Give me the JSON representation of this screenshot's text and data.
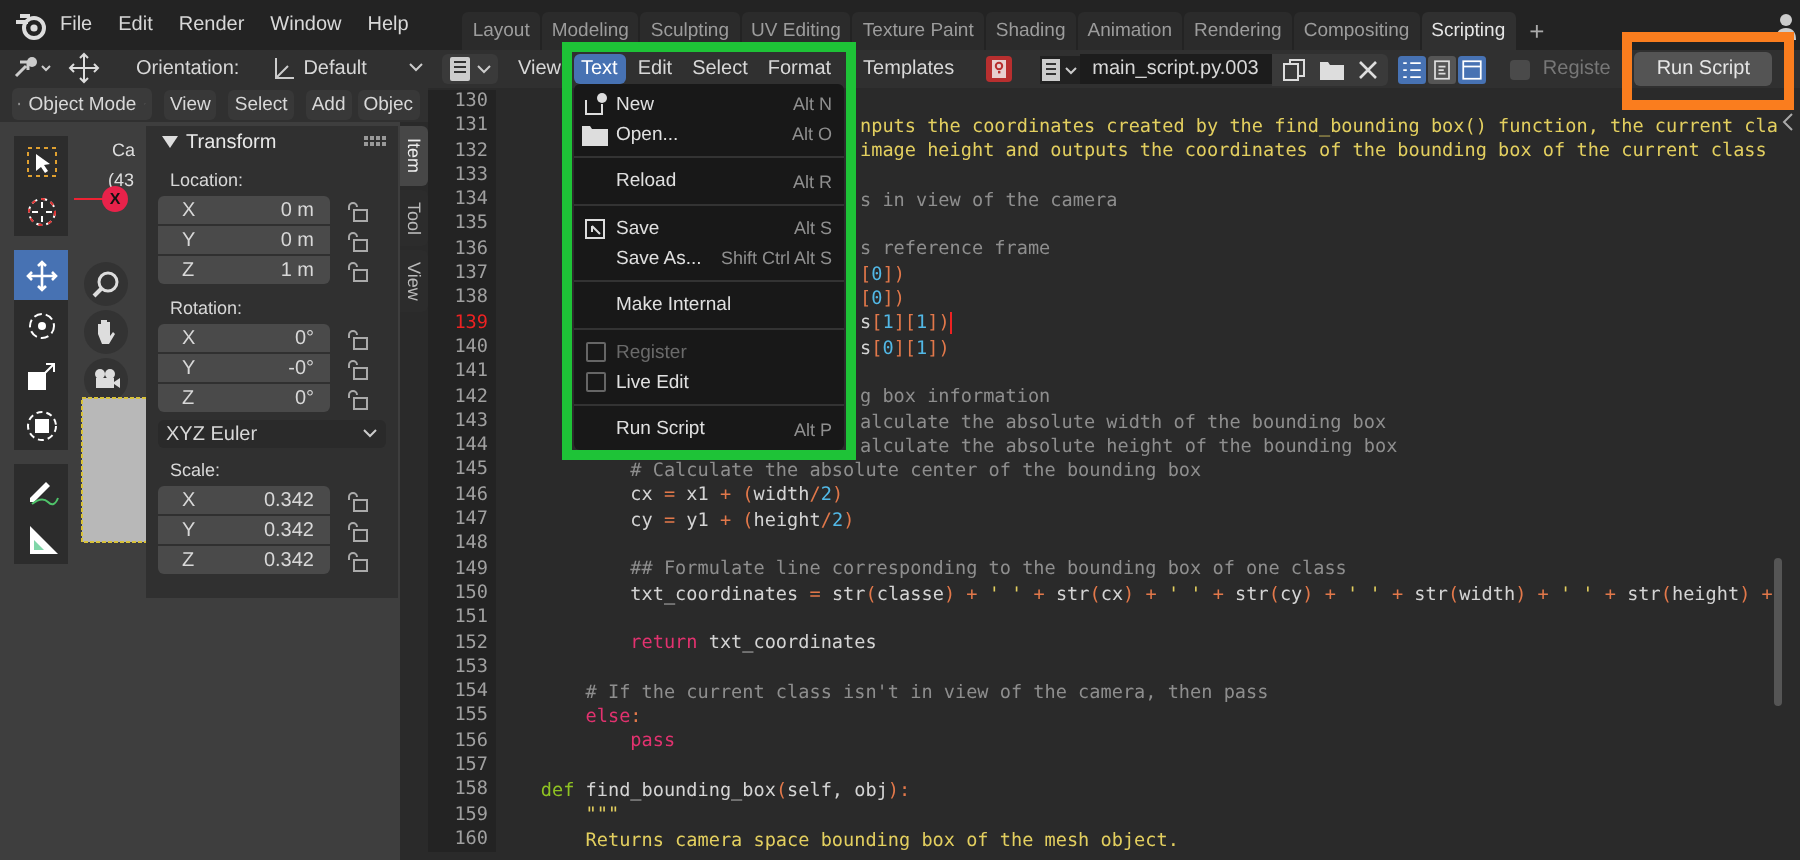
{
  "topbar": {
    "menus": [
      "File",
      "Edit",
      "Render",
      "Window",
      "Help"
    ],
    "workspaces": [
      {
        "label": "Layout",
        "selected": false
      },
      {
        "label": "Modeling",
        "selected": false
      },
      {
        "label": "Sculpting",
        "selected": false
      },
      {
        "label": "UV Editing",
        "selected": false
      },
      {
        "label": "Texture Paint",
        "selected": false
      },
      {
        "label": "Shading",
        "selected": false
      },
      {
        "label": "Animation",
        "selected": false
      },
      {
        "label": "Rendering",
        "selected": false
      },
      {
        "label": "Compositing",
        "selected": false
      },
      {
        "label": "Scripting",
        "selected": true
      }
    ],
    "add_tab": "+"
  },
  "viewport": {
    "orientation_label": "Orientation:",
    "orientation": "Default",
    "mode": "Object Mode",
    "menus": [
      "View",
      "Select",
      "Add",
      "Objec"
    ],
    "overlay_text": [
      "Ca",
      "(43"
    ],
    "axis_handle": "X",
    "tools": [
      {
        "kind": "select-box",
        "selected": false
      },
      {
        "kind": "cursor",
        "selected": false
      },
      {
        "kind": "move",
        "selected": true
      },
      {
        "kind": "rotate",
        "selected": false
      },
      {
        "kind": "scale",
        "selected": false
      },
      {
        "kind": "transform",
        "selected": false
      },
      {
        "kind": "annotate",
        "selected": false
      },
      {
        "kind": "measure",
        "selected": false
      }
    ],
    "transform": {
      "title": "Transform",
      "sections": [
        {
          "label": "Location:",
          "fields": [
            {
              "axis": "X",
              "value": "0 m"
            },
            {
              "axis": "Y",
              "value": "0 m"
            },
            {
              "axis": "Z",
              "value": "1 m"
            }
          ]
        },
        {
          "label": "Rotation:",
          "fields": [
            {
              "axis": "X",
              "value": "0°"
            },
            {
              "axis": "Y",
              "value": "-0°"
            },
            {
              "axis": "Z",
              "value": "0°"
            }
          ],
          "mode": "XYZ Euler"
        },
        {
          "label": "Scale:",
          "fields": [
            {
              "axis": "X",
              "value": "0.342"
            },
            {
              "axis": "Y",
              "value": "0.342"
            },
            {
              "axis": "Z",
              "value": "0.342"
            }
          ]
        }
      ]
    },
    "side_tabs": [
      {
        "label": "Item",
        "selected": true
      },
      {
        "label": "Tool",
        "selected": false
      },
      {
        "label": "View",
        "selected": false
      }
    ]
  },
  "editor": {
    "menus": [
      {
        "label": "View",
        "selected": false
      },
      {
        "label": "Text",
        "selected": true
      },
      {
        "label": "Edit",
        "selected": false
      },
      {
        "label": "Select",
        "selected": false
      },
      {
        "label": "Format",
        "selected": false
      },
      {
        "label": "Templates",
        "selected": false
      }
    ],
    "filename": "main_script.py.003",
    "toggles": [
      {
        "kind": "line-numbers",
        "on": true
      },
      {
        "kind": "word-wrap",
        "on": false
      },
      {
        "kind": "syntax",
        "on": true
      }
    ],
    "register": {
      "label": "Registe",
      "checked": false
    },
    "run_button": {
      "label": "Run Script",
      "highlighted": true
    },
    "lines": [
      {
        "n": "130",
        "current": false
      },
      {
        "n": "131",
        "current": false,
        "covered": true,
        "spans": [
          {
            "text": "nputs the coordinates created by the find_bounding box() function, the current cla",
            "kind": "doc"
          }
        ]
      },
      {
        "n": "132",
        "current": false,
        "covered": true,
        "spans": [
          {
            "text": "image height and outputs the coordinates of the bounding box of the current class",
            "kind": "doc"
          }
        ]
      },
      {
        "n": "133",
        "current": false
      },
      {
        "n": "134",
        "current": false,
        "covered": true,
        "spans": [
          {
            "text": "s in view of the camera",
            "kind": "comment"
          }
        ]
      },
      {
        "n": "135",
        "current": false
      },
      {
        "n": "136",
        "current": false,
        "covered": true,
        "spans": [
          {
            "text": "s reference frame",
            "kind": "comment"
          }
        ]
      },
      {
        "n": "137",
        "current": false,
        "covered": true,
        "spans": [
          {
            "text": "[",
            "kind": "op"
          },
          {
            "text": "0",
            "kind": "num"
          },
          {
            "text": "])",
            "kind": "op"
          }
        ]
      },
      {
        "n": "138",
        "current": false,
        "covered": true,
        "spans": [
          {
            "text": "[",
            "kind": "op"
          },
          {
            "text": "0",
            "kind": "num"
          },
          {
            "text": "])",
            "kind": "op"
          }
        ]
      },
      {
        "n": "139",
        "current": true,
        "covered": true,
        "spans": [
          {
            "text": "s",
            "kind": "plain"
          },
          {
            "text": "[",
            "kind": "op"
          },
          {
            "text": "1",
            "kind": "num"
          },
          {
            "text": "][",
            "kind": "op"
          },
          {
            "text": "1",
            "kind": "num"
          },
          {
            "text": "])",
            "kind": "op"
          }
        ]
      },
      {
        "n": "140",
        "current": false,
        "covered": true,
        "spans": [
          {
            "text": "s",
            "kind": "plain"
          },
          {
            "text": "[",
            "kind": "op"
          },
          {
            "text": "0",
            "kind": "num"
          },
          {
            "text": "][",
            "kind": "op"
          },
          {
            "text": "1",
            "kind": "num"
          },
          {
            "text": "])",
            "kind": "op"
          }
        ]
      },
      {
        "n": "141",
        "current": false
      },
      {
        "n": "142",
        "current": false,
        "covered": true,
        "spans": [
          {
            "text": "g box information",
            "kind": "comment"
          }
        ]
      },
      {
        "n": "143",
        "current": false,
        "covered": true,
        "spans": [
          {
            "text": "alculate the absolute width of the bounding box",
            "kind": "comment"
          }
        ]
      },
      {
        "n": "144",
        "current": false,
        "covered": true,
        "spans": [
          {
            "text": "alculate the absolute height of the bounding box",
            "kind": "comment"
          }
        ]
      },
      {
        "n": "145",
        "current": false,
        "covered": false,
        "spans": [
          {
            "text": "            # Calculate the absolute center of the bounding box",
            "kind": "comment"
          }
        ]
      },
      {
        "n": "146",
        "current": false,
        "covered": false,
        "spans": [
          {
            "text": "            cx ",
            "kind": "plain"
          },
          {
            "text": "=",
            "kind": "op"
          },
          {
            "text": " x1 ",
            "kind": "plain"
          },
          {
            "text": "+ (",
            "kind": "op"
          },
          {
            "text": "width",
            "kind": "plain"
          },
          {
            "text": "/",
            "kind": "op"
          },
          {
            "text": "2",
            "kind": "num"
          },
          {
            "text": ")",
            "kind": "op"
          }
        ]
      },
      {
        "n": "147",
        "current": false,
        "covered": false,
        "spans": [
          {
            "text": "            cy ",
            "kind": "plain"
          },
          {
            "text": "=",
            "kind": "op"
          },
          {
            "text": " y1 ",
            "kind": "plain"
          },
          {
            "text": "+ (",
            "kind": "op"
          },
          {
            "text": "height",
            "kind": "plain"
          },
          {
            "text": "/",
            "kind": "op"
          },
          {
            "text": "2",
            "kind": "num"
          },
          {
            "text": ")",
            "kind": "op"
          }
        ]
      },
      {
        "n": "148",
        "current": false
      },
      {
        "n": "149",
        "current": false,
        "covered": false,
        "spans": [
          {
            "text": "            ## Formulate line corresponding to the bounding box of one class",
            "kind": "comment"
          }
        ]
      },
      {
        "n": "150",
        "current": false,
        "covered": false,
        "spans": [
          {
            "text": "            txt_coordinates ",
            "kind": "plain"
          },
          {
            "text": "=",
            "kind": "op"
          },
          {
            "text": " str",
            "kind": "plain"
          },
          {
            "text": "(",
            "kind": "op"
          },
          {
            "text": "classe",
            "kind": "plain"
          },
          {
            "text": ") +",
            "kind": "op"
          },
          {
            "text": " ' ' ",
            "kind": "doc"
          },
          {
            "text": "+",
            "kind": "op"
          },
          {
            "text": " str",
            "kind": "plain"
          },
          {
            "text": "(",
            "kind": "op"
          },
          {
            "text": "cx",
            "kind": "plain"
          },
          {
            "text": ") +",
            "kind": "op"
          },
          {
            "text": " ' ' ",
            "kind": "doc"
          },
          {
            "text": "+",
            "kind": "op"
          },
          {
            "text": " str",
            "kind": "plain"
          },
          {
            "text": "(",
            "kind": "op"
          },
          {
            "text": "cy",
            "kind": "plain"
          },
          {
            "text": ") +",
            "kind": "op"
          },
          {
            "text": " ' ' ",
            "kind": "doc"
          },
          {
            "text": "+",
            "kind": "op"
          },
          {
            "text": " str",
            "kind": "plain"
          },
          {
            "text": "(",
            "kind": "op"
          },
          {
            "text": "width",
            "kind": "plain"
          },
          {
            "text": ") +",
            "kind": "op"
          },
          {
            "text": " ' ' ",
            "kind": "doc"
          },
          {
            "text": "+",
            "kind": "op"
          },
          {
            "text": " str",
            "kind": "plain"
          },
          {
            "text": "(",
            "kind": "op"
          },
          {
            "text": "height",
            "kind": "plain"
          },
          {
            "text": ") +",
            "kind": "op"
          }
        ]
      },
      {
        "n": "151",
        "current": false
      },
      {
        "n": "152",
        "current": false,
        "covered": false,
        "spans": [
          {
            "text": "            return",
            "kind": "keyword"
          },
          {
            "text": " txt_coordinates",
            "kind": "plain"
          }
        ]
      },
      {
        "n": "153",
        "current": false
      },
      {
        "n": "154",
        "current": false,
        "covered": false,
        "spans": [
          {
            "text": "        # If the current class isn't in view of the camera, then pass",
            "kind": "comment"
          }
        ]
      },
      {
        "n": "155",
        "current": false,
        "covered": false,
        "spans": [
          {
            "text": "        else",
            "kind": "keyword"
          },
          {
            "text": ":",
            "kind": "op"
          }
        ]
      },
      {
        "n": "156",
        "current": false,
        "covered": false,
        "spans": [
          {
            "text": "            pass",
            "kind": "keyword"
          }
        ]
      },
      {
        "n": "157",
        "current": false
      },
      {
        "n": "158",
        "current": false,
        "covered": false,
        "spans": [
          {
            "text": "    def",
            "kind": "def"
          },
          {
            "text": " find_bounding_box",
            "kind": "plain"
          },
          {
            "text": "(",
            "kind": "op"
          },
          {
            "text": "self, obj",
            "kind": "plain"
          },
          {
            "text": "):",
            "kind": "op"
          }
        ]
      },
      {
        "n": "159",
        "current": false,
        "covered": false,
        "spans": [
          {
            "text": "        \"\"\"",
            "kind": "doc"
          }
        ]
      },
      {
        "n": "160",
        "current": false,
        "covered": false,
        "spans": [
          {
            "text": "        Returns camera space bounding box of the mesh object.",
            "kind": "doc"
          }
        ]
      }
    ]
  },
  "text_menu": {
    "highlighted": true,
    "items": [
      {
        "kind": "item",
        "label": "New",
        "shortcut": "Alt N"
      },
      {
        "kind": "item",
        "label": "Open...",
        "shortcut": "Alt O"
      },
      {
        "kind": "separator"
      },
      {
        "kind": "item",
        "label": "Reload",
        "shortcut": "Alt R"
      },
      {
        "kind": "separator"
      },
      {
        "kind": "item",
        "label": "Save",
        "shortcut": "Alt S"
      },
      {
        "kind": "item",
        "label": "Save As...",
        "shortcut": "Shift Ctrl Alt S"
      },
      {
        "kind": "separator"
      },
      {
        "kind": "item",
        "label": "Make Internal"
      },
      {
        "kind": "separator"
      },
      {
        "kind": "check",
        "label": "Register",
        "checked": false,
        "disabled": true
      },
      {
        "kind": "check",
        "label": "Live Edit",
        "checked": false,
        "disabled": false
      },
      {
        "kind": "separator"
      },
      {
        "kind": "item",
        "label": "Run Script",
        "shortcut": "Alt P"
      }
    ]
  }
}
